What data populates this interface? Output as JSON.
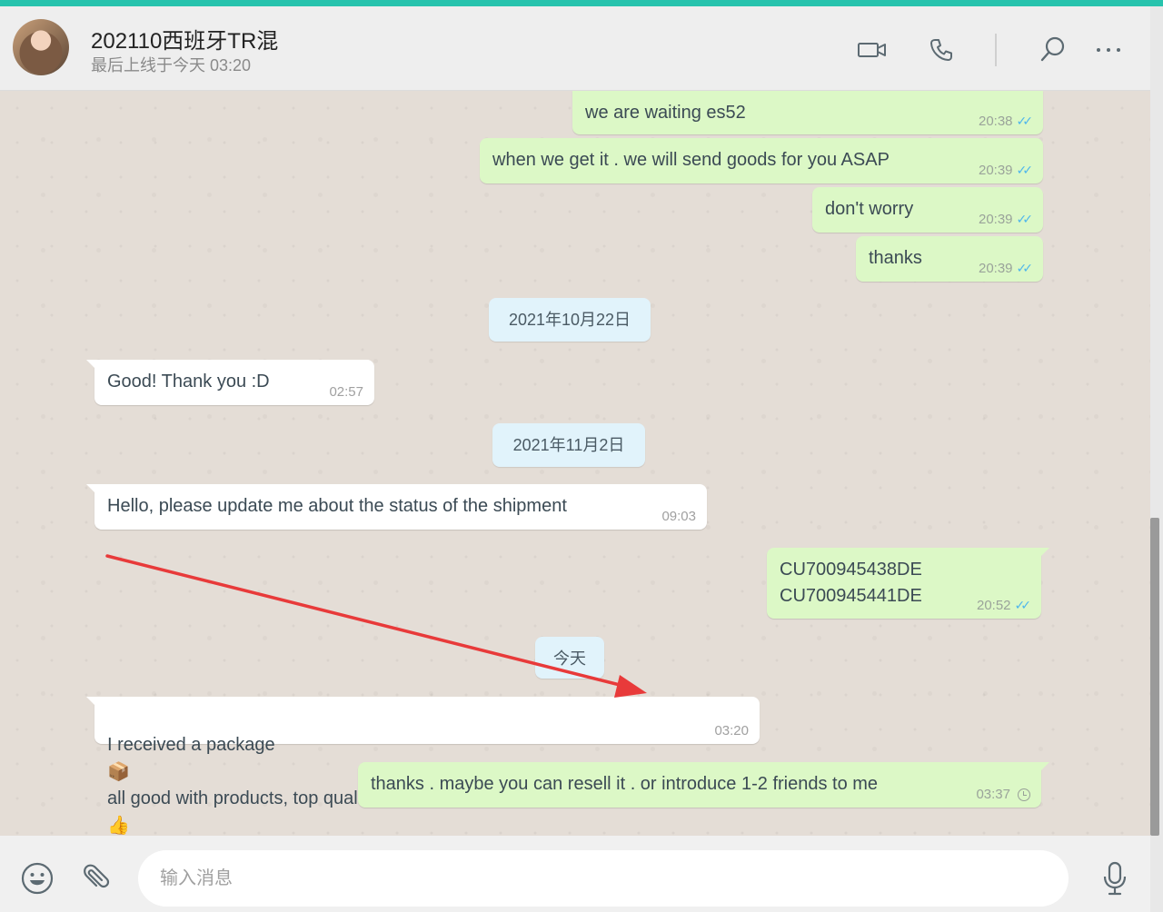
{
  "contact": {
    "name": "202110西班牙TR混",
    "status": "最后上线于今天 03:20"
  },
  "header_icons": [
    "video-call-icon",
    "voice-call-icon",
    "search-icon",
    "more-options-icon"
  ],
  "messages": [
    {
      "direction": "out",
      "text": "we are waiting es52",
      "time": "20:38",
      "status": "read"
    },
    {
      "direction": "out",
      "text": "when we get it . we will send goods for you ASAP",
      "time": "20:39",
      "status": "read"
    },
    {
      "direction": "out",
      "text": "don't worry",
      "time": "20:39",
      "status": "read"
    },
    {
      "direction": "out",
      "text": "thanks",
      "time": "20:39",
      "status": "read"
    },
    {
      "direction": "in",
      "text": "Good! Thank you :D",
      "time": "02:57"
    },
    {
      "direction": "in",
      "text": "Hello, please update me about the status of the shipment",
      "time": "09:03"
    },
    {
      "direction": "out",
      "text": "CU700945438DE\nCU700945441DE",
      "time": "20:52",
      "status": "read"
    },
    {
      "direction": "in",
      "text_a": "I received a package",
      "emoji_a": "📦",
      "text_b": "all good with products, top quality",
      "emoji_b": "👍",
      "time": "03:20"
    },
    {
      "direction": "out",
      "text": "thanks . maybe you can resell it . or introduce 1-2 friends to me",
      "time": "03:37",
      "status": "pending"
    }
  ],
  "dates": [
    "2021年10月22日",
    "2021年11月2日",
    "今天"
  ],
  "composer": {
    "placeholder": "输入消息"
  },
  "colors": {
    "accent_bar": "#27c3ad",
    "outgoing_bubble": "#dcf8c6",
    "incoming_bubble": "#ffffff",
    "date_pill": "#e1f3fb",
    "read_tick": "#4fb6ec",
    "annotation_arrow": "#e83a3a"
  }
}
